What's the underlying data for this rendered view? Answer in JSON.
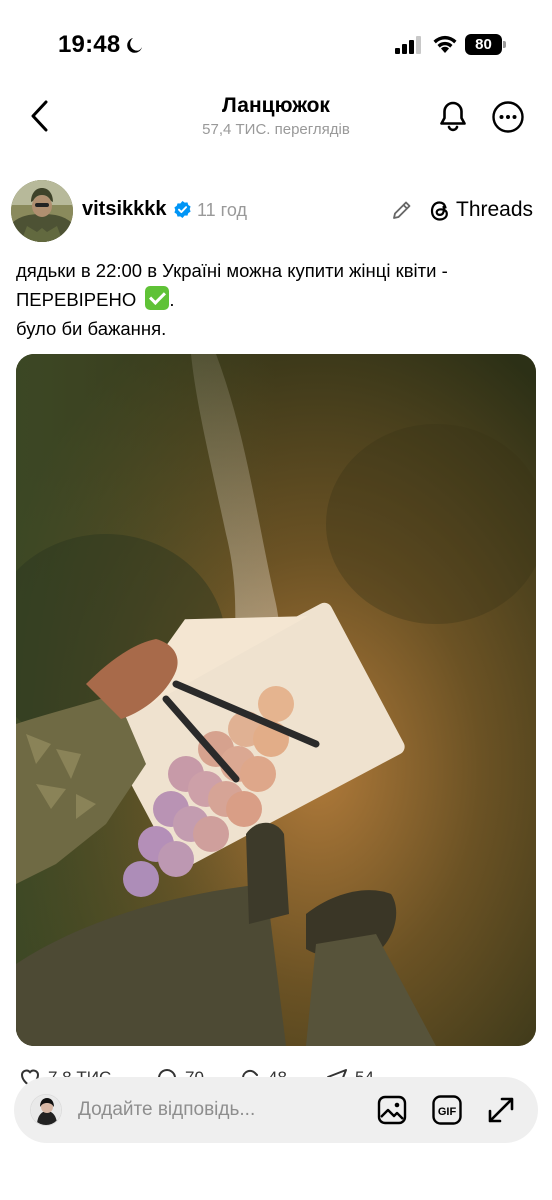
{
  "status_bar": {
    "time": "19:48",
    "battery": "80"
  },
  "header": {
    "title": "Ланцюжок",
    "views": "57,4 ТИС. переглядів"
  },
  "post": {
    "username": "vitsikkkk",
    "time": "11 год",
    "platform_label": "Threads",
    "text_line_1": "дядьки в 22:00 в Україні можна купити жінці квіти -",
    "text_line_2": "ПЕРЕВІРЕНО",
    "text_line_3": "було би бажання."
  },
  "actions": {
    "likes": "7,8 ТИС.",
    "comments": "70",
    "reposts": "48",
    "shares": "54"
  },
  "reply": {
    "placeholder": "Додайте відповідь..."
  },
  "icons": {
    "back": "chevron-left-icon",
    "notifications": "bell-icon",
    "more": "more-icon",
    "verified": "verified-icon",
    "edit": "pencil-icon",
    "threads": "threads-logo-icon",
    "check": "check-mark-icon",
    "image": "image-icon",
    "gif": "gif-icon",
    "expand": "expand-icon"
  },
  "colors": {
    "verified": "#0095f6",
    "secondary_text": "#999999",
    "reply_bar": "#efefef",
    "check": "#5fc236"
  }
}
